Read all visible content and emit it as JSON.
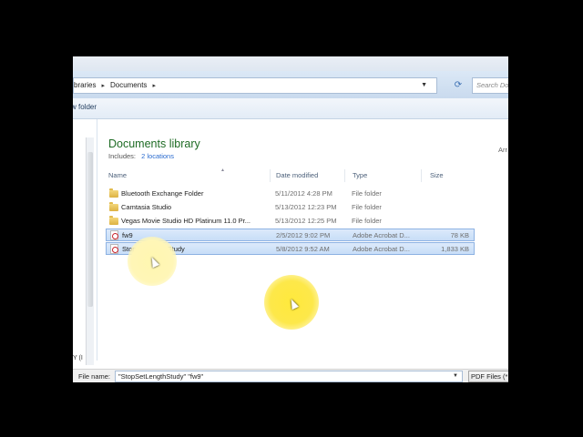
{
  "address": {
    "crumbs": [
      "braries",
      "Documents"
    ],
    "search_placeholder": "Search Do"
  },
  "toolbar": {
    "new_folder_label": "w folder"
  },
  "nav": {
    "truncated_label": "Y (I"
  },
  "library": {
    "title": "Documents library",
    "includes_label": "Includes:",
    "includes_link": "2 locations",
    "arrange_by": "Arr"
  },
  "columns": {
    "name": "Name",
    "date": "Date modified",
    "type": "Type",
    "size": "Size"
  },
  "files": [
    {
      "name": "Bluetooth Exchange Folder",
      "date": "5/11/2012 4:28 PM",
      "type": "File folder",
      "size": "",
      "icon": "folder-icon",
      "selected": false
    },
    {
      "name": "Camtasia Studio",
      "date": "5/13/2012 12:23 PM",
      "type": "File folder",
      "size": "",
      "icon": "folder-icon",
      "selected": false
    },
    {
      "name": "Vegas Movie Studio HD Platinum 11.0 Pr...",
      "date": "5/13/2012 12:25 PM",
      "type": "File folder",
      "size": "",
      "icon": "folder-icon",
      "selected": false
    },
    {
      "name": "fw9",
      "date": "2/5/2012 9:02 PM",
      "type": "Adobe Acrobat D...",
      "size": "78 KB",
      "icon": "pdf-icon",
      "selected": true
    },
    {
      "name": "StopSetLengthStudy",
      "date": "5/8/2012 9:52 AM",
      "type": "Adobe Acrobat D...",
      "size": "1,833 KB",
      "icon": "pdf-icon",
      "selected": true
    }
  ],
  "footer": {
    "filename_label": "File name:",
    "filename_value": "\"StopSetLengthStudy\" \"fw9\"",
    "filetype_value": "PDF Files (*"
  },
  "colors": {
    "library_title": "#1e6b24",
    "link": "#2a6bcf",
    "selection": "#c7ddf7",
    "highlight": "#fde84a"
  }
}
